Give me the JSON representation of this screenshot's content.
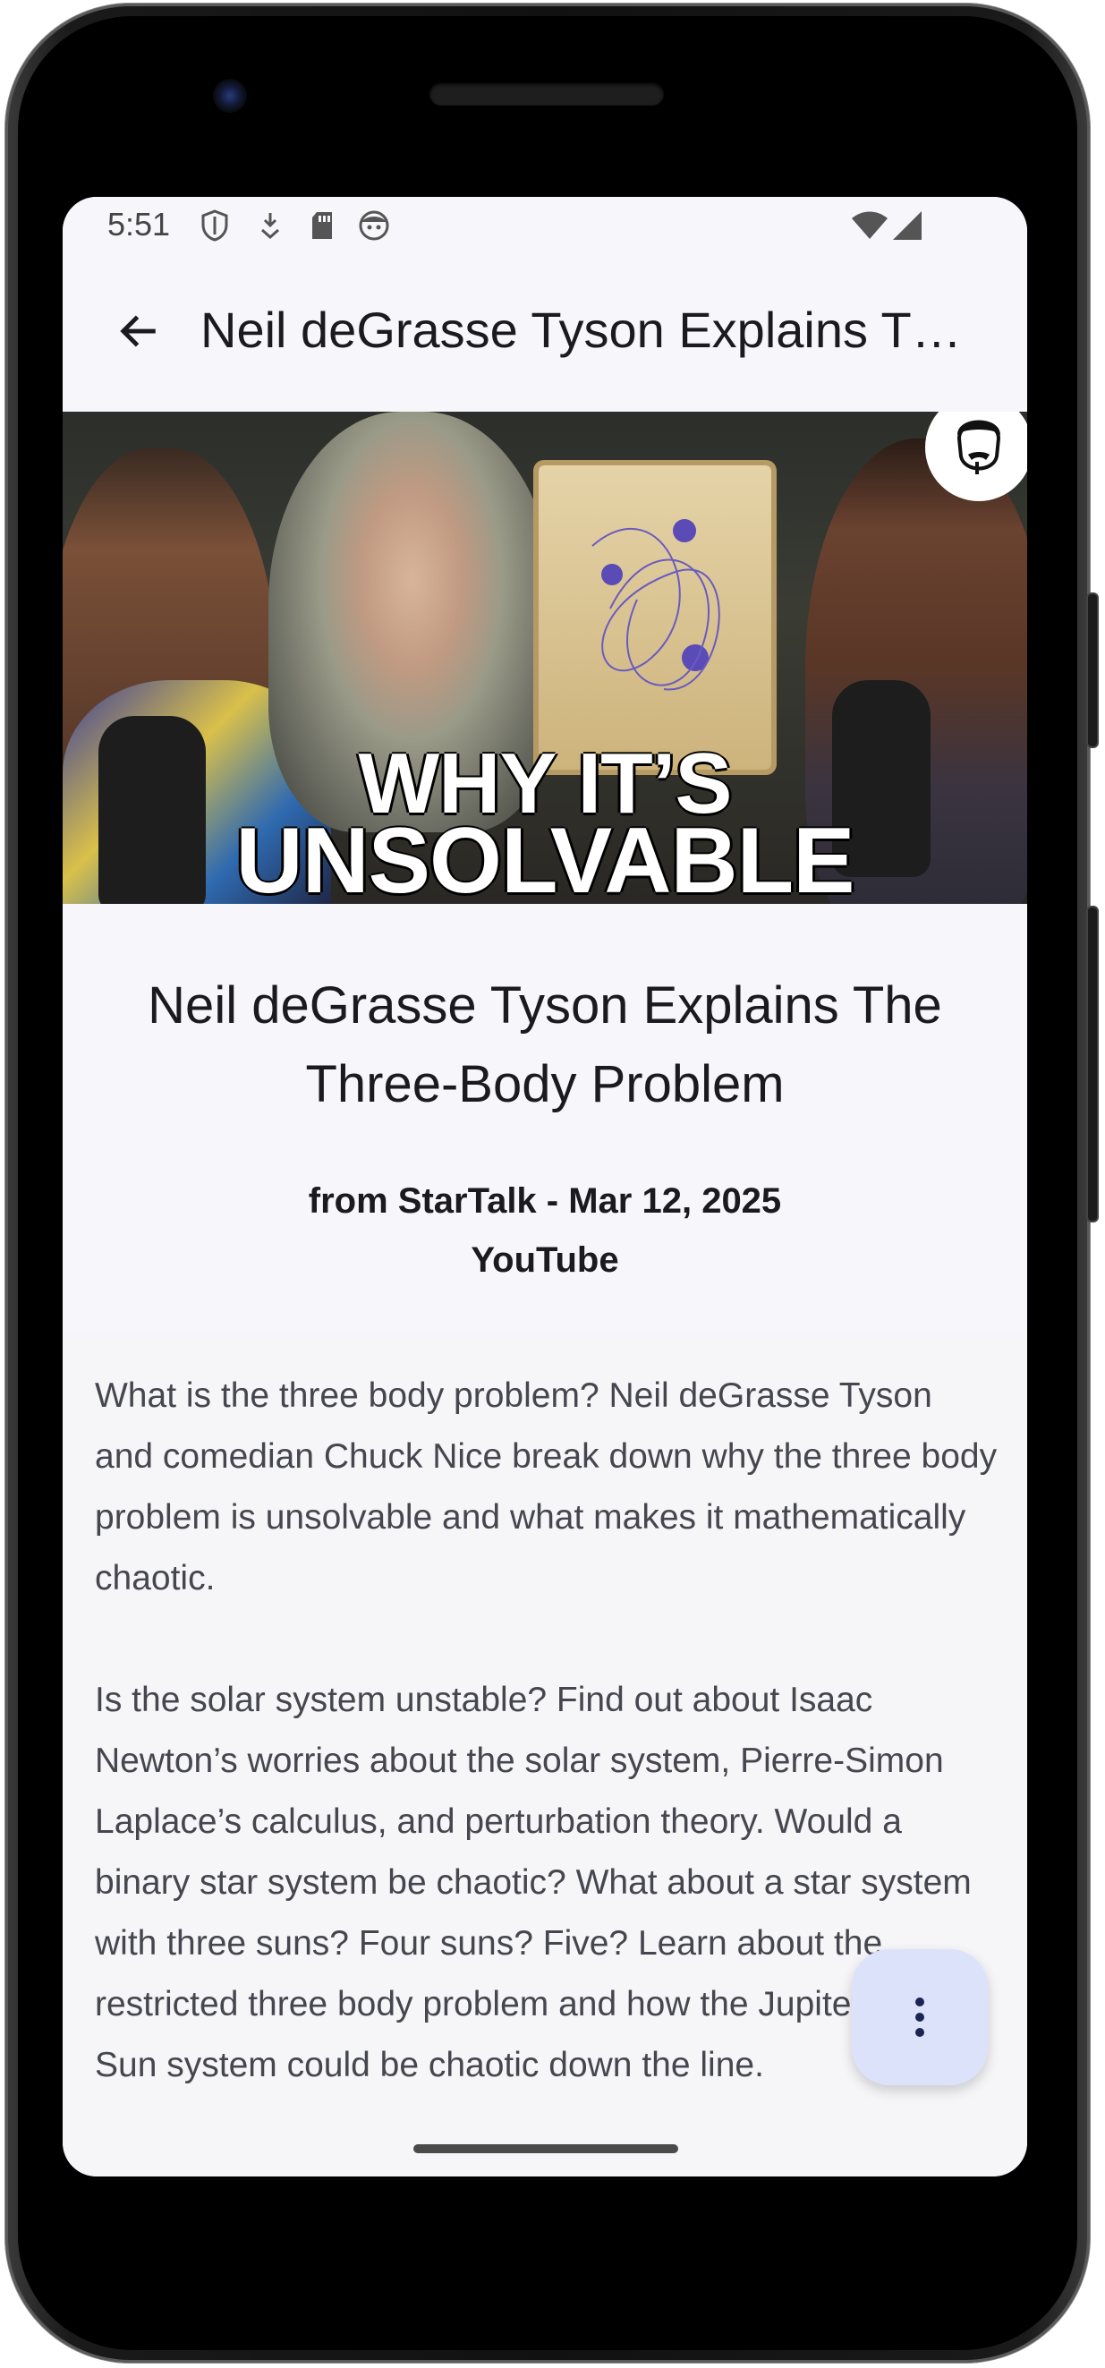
{
  "status_bar": {
    "time": "5:51",
    "icons": [
      "shield-icon",
      "download-icon",
      "sd-card-icon",
      "face-icon"
    ],
    "right_icons": [
      "wifi-icon",
      "signal-icon"
    ]
  },
  "app_bar": {
    "title": "Neil deGrasse Tyson Explains T…",
    "back_icon": "arrow-back-icon"
  },
  "thumbnail": {
    "line1": "WHY IT’S",
    "line2": "UNSOLVABLE"
  },
  "video": {
    "title": "Neil deGrasse Tyson Explains The Three-Body Problem",
    "meta": "from StarTalk - Mar 12, 2025",
    "platform": "YouTube"
  },
  "description": {
    "paragraphs": [
      "What is the three body problem? Neil deGrasse Tyson and comedian Chuck Nice break down why the three body problem is unsolvable and what makes it mathematically chaotic.",
      "Is the solar system unstable? Find out about Isaac Newton’s worries about the solar system, Pierre-Simon Laplace’s calculus, and perturbation theory. Would a binary star system be chaotic? What about a star system with three suns? Four suns? Five? Learn about the restricted three body problem and how the Jupiter-Earth-Sun system could be chaotic down the line."
    ]
  },
  "fab": {
    "icon": "more-vert-icon"
  },
  "colors": {
    "background": "#f7f7fb",
    "fab": "#dde2fb",
    "text_primary": "#1b1b1f",
    "text_secondary": "#46464f"
  }
}
